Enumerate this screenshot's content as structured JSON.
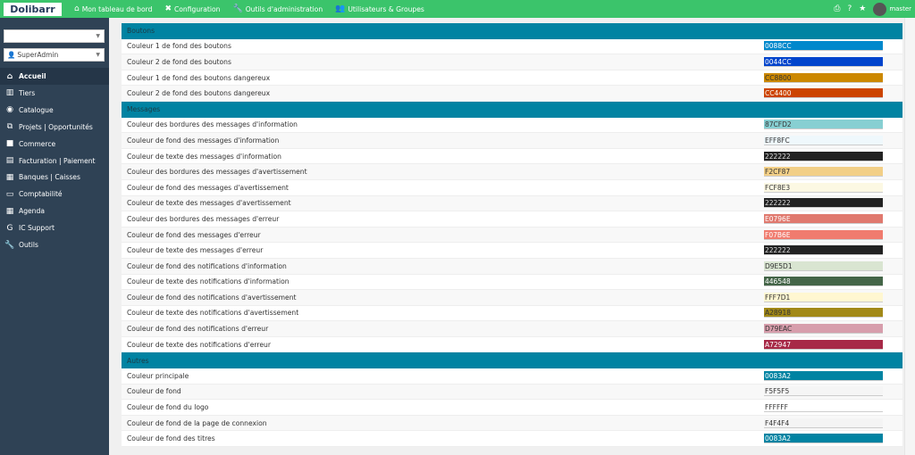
{
  "topbar": {
    "logo": "Dolibarr",
    "menu": [
      {
        "icon": "home-icon",
        "glyph": "⌂",
        "label": "Mon tableau de bord"
      },
      {
        "icon": "tools-icon",
        "glyph": "✖",
        "label": "Configuration"
      },
      {
        "icon": "wrench-icon",
        "glyph": "🔧",
        "label": "Outils d'administration"
      },
      {
        "icon": "users-icon",
        "glyph": "👥",
        "label": "Utilisateurs & Groupes"
      }
    ],
    "user": "master"
  },
  "sidebar": {
    "select1": "",
    "select2": "SuperAdmin",
    "items": [
      {
        "icon": "home-icon",
        "glyph": "⌂",
        "label": "Accueil",
        "active": true
      },
      {
        "icon": "building-icon",
        "glyph": "▥",
        "label": "Tiers"
      },
      {
        "icon": "cube-icon",
        "glyph": "◉",
        "label": "Catalogue"
      },
      {
        "icon": "sitemap-icon",
        "glyph": "⧉",
        "label": "Projets | Opportunités"
      },
      {
        "icon": "briefcase-icon",
        "glyph": "■",
        "label": "Commerce"
      },
      {
        "icon": "invoice-icon",
        "glyph": "▤",
        "label": "Facturation | Paiement"
      },
      {
        "icon": "bank-icon",
        "glyph": "▦",
        "label": "Banques | Caisses"
      },
      {
        "icon": "accounting-icon",
        "glyph": "▭",
        "label": "Comptabilité"
      },
      {
        "icon": "calendar-icon",
        "glyph": "▦",
        "label": "Agenda"
      },
      {
        "icon": "support-icon",
        "glyph": "G",
        "label": "IC Support"
      },
      {
        "icon": "wrench-icon",
        "glyph": "🔧",
        "label": "Outils"
      }
    ]
  },
  "sections": [
    {
      "title": "Boutons",
      "rows": [
        {
          "label": "Couleur 1 de fond des boutons",
          "value": "0088CC",
          "color": "#0088CC",
          "text": "#ffffff"
        },
        {
          "label": "Couleur 2 de fond des boutons",
          "value": "0044CC",
          "color": "#0044CC",
          "text": "#ffffff"
        },
        {
          "label": "Couleur 1 de fond des boutons dangereux",
          "value": "CC8800",
          "color": "#CC8800",
          "text": "#333333"
        },
        {
          "label": "Couleur 2 de fond des boutons dangereux",
          "value": "CC4400",
          "color": "#CC4400",
          "text": "#ffffff"
        }
      ]
    },
    {
      "title": "Messages",
      "rows": [
        {
          "label": "Couleur des bordures des messages d'information",
          "value": "87CFD2",
          "color": "#87CFD2",
          "text": "#333333"
        },
        {
          "label": "Couleur de fond des messages d'information",
          "value": "EFF8FC",
          "color": "#EFF8FC",
          "text": "#333333"
        },
        {
          "label": "Couleur de texte des messages d'information",
          "value": "222222",
          "color": "#222222",
          "text": "#dddddd"
        },
        {
          "label": "Couleur des bordures des messages d'avertissement",
          "value": "F2CF87",
          "color": "#F2CF87",
          "text": "#333333"
        },
        {
          "label": "Couleur de fond des messages d'avertissement",
          "value": "FCF8E3",
          "color": "#FCF8E3",
          "text": "#333333"
        },
        {
          "label": "Couleur de texte des messages d'avertissement",
          "value": "222222",
          "color": "#222222",
          "text": "#dddddd"
        },
        {
          "label": "Couleur des bordures des messages d'erreur",
          "value": "E0796E",
          "color": "#E0796E",
          "text": "#ffffff"
        },
        {
          "label": "Couleur de fond des messages d'erreur",
          "value": "F07B6E",
          "color": "#F07B6E",
          "text": "#ffffff"
        },
        {
          "label": "Couleur de texte des messages d'erreur",
          "value": "222222",
          "color": "#222222",
          "text": "#dddddd"
        },
        {
          "label": "Couleur de fond des notifications d'information",
          "value": "D9E5D1",
          "color": "#D9E5D1",
          "text": "#333333"
        },
        {
          "label": "Couleur de texte des notifications d'information",
          "value": "446548",
          "color": "#446548",
          "text": "#ffffff"
        },
        {
          "label": "Couleur de fond des notifications d'avertissement",
          "value": "FFF7D1",
          "color": "#FFF7D1",
          "text": "#333333"
        },
        {
          "label": "Couleur de texte des notifications d'avertissement",
          "value": "A28918",
          "color": "#A28918",
          "text": "#333333"
        },
        {
          "label": "Couleur de fond des notifications d'erreur",
          "value": "D79EAC",
          "color": "#D79EAC",
          "text": "#333333"
        },
        {
          "label": "Couleur de texte des notifications d'erreur",
          "value": "A72947",
          "color": "#A72947",
          "text": "#ffffff"
        }
      ]
    },
    {
      "title": "Autres",
      "rows": [
        {
          "label": "Couleur principale",
          "value": "0083A2",
          "color": "#0083A2",
          "text": "#ffffff"
        },
        {
          "label": "Couleur de fond",
          "value": "F5F5F5",
          "color": "#F5F5F5",
          "text": "#333333"
        },
        {
          "label": "Couleur de fond du logo",
          "value": "FFFFFF",
          "color": "#FFFFFF",
          "text": "#333333"
        },
        {
          "label": "Couleur de fond de la page de connexion",
          "value": "F4F4F4",
          "color": "#F4F4F4",
          "text": "#333333"
        },
        {
          "label": "Couleur de fond des titres",
          "value": "0083A2",
          "color": "#0083A2",
          "text": "#ffffff"
        }
      ]
    }
  ]
}
